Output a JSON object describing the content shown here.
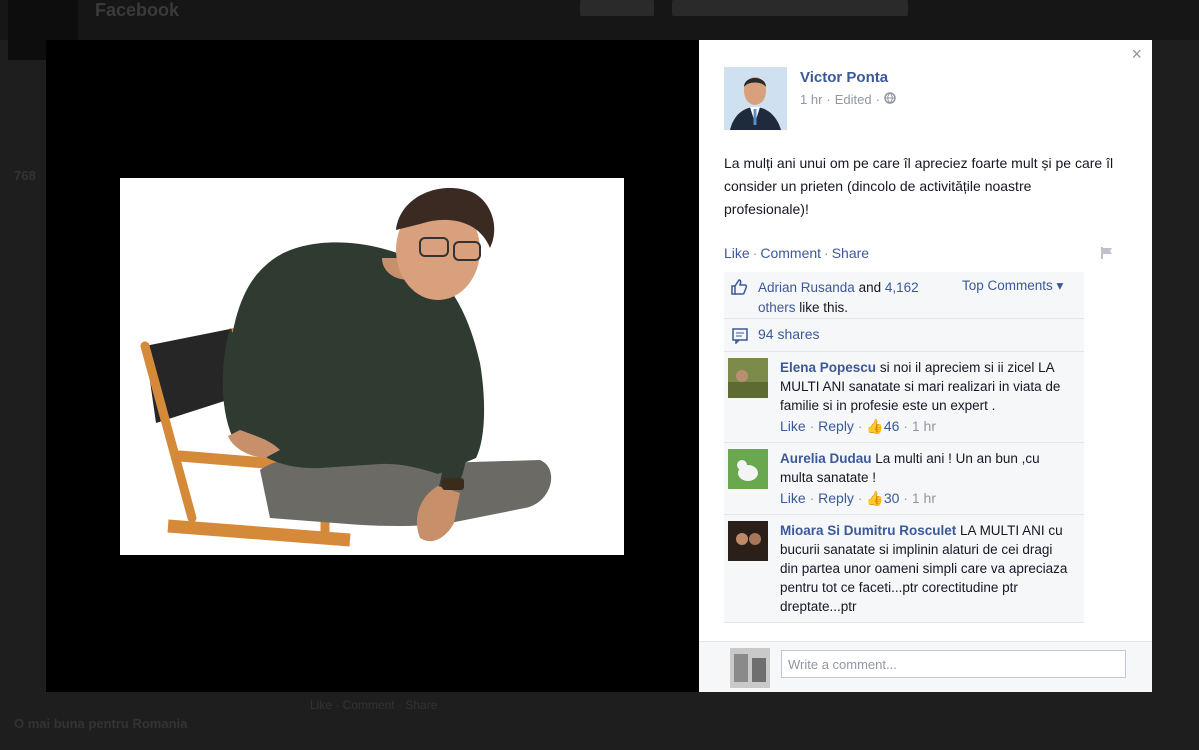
{
  "background": {
    "title": "Facebook",
    "count": "768",
    "footer": "O mai buna pentru Romania",
    "strip": "Like · Comment · Share"
  },
  "panel": {
    "close_label": "×",
    "author": "Victor Ponta",
    "timestamp": "1 hr",
    "edited": "Edited",
    "post_text": "La mulți ani unui om pe care îl apreciez foarte mult și pe care îl consider un prieten (dincolo de activitățile noastre profesionale)!",
    "actions": {
      "like": "Like",
      "comment": "Comment",
      "share": "Share"
    },
    "likes": {
      "first_name": "Adrian Rusanda",
      "and": "and",
      "others_link": "4,162 others",
      "suffix": "like this."
    },
    "top_comments": "Top Comments ▾",
    "shares": "94 shares",
    "comments": [
      {
        "name": "Elena Popescu",
        "text": "si noi il apreciem si ii zicel LA MULTI ANI sanatate si mari realizari in viata de familie si in profesie este un expert .",
        "like": "Like",
        "reply": "Reply",
        "likes": "46",
        "time": "1 hr"
      },
      {
        "name": "Aurelia Dudau",
        "text": "La multi ani ! Un an bun ,cu multa sanatate !",
        "like": "Like",
        "reply": "Reply",
        "likes": "30",
        "time": "1 hr"
      },
      {
        "name": "Mioara Si Dumitru Rosculet",
        "text": "LA MULTI ANI cu bucurii sanatate si implinin alaturi de cei dragi din partea unor oameni simpli care va apreciaza pentru tot ce faceti...ptr corectitudine ptr dreptate...ptr",
        "like": "",
        "reply": "",
        "likes": "",
        "time": ""
      }
    ],
    "write_placeholder": "Write a comment..."
  },
  "colors": {
    "link": "#3b5998",
    "muted": "#9197a3",
    "panel_bg": "#ffffff",
    "ufi_bg": "#f6f7f8"
  }
}
